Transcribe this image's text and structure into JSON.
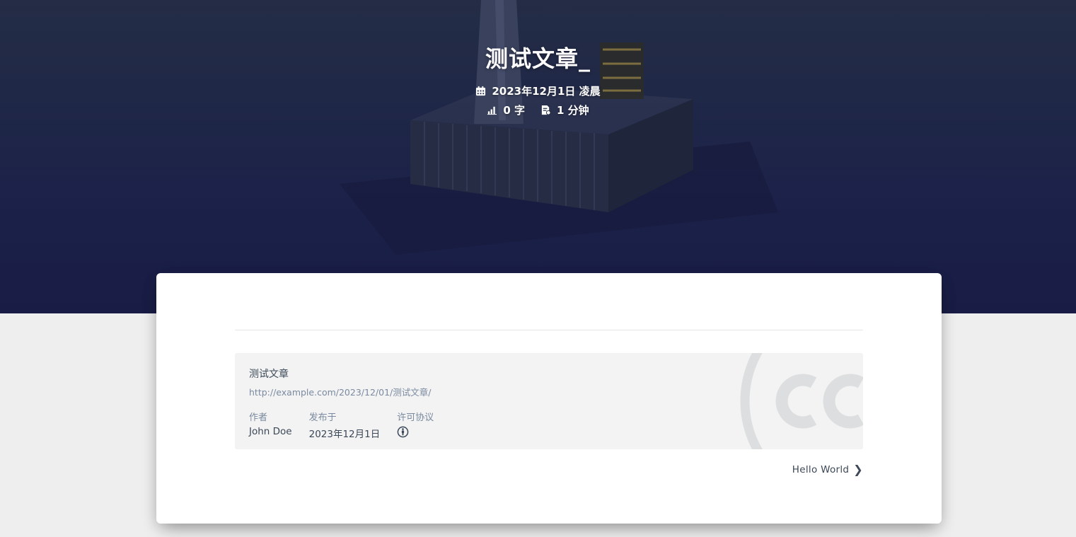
{
  "banner": {
    "title": "测试文章_",
    "date": "2023年12月1日 凌晨",
    "word_count": "0 字",
    "read_time": "1 分钟",
    "icons": {
      "date": "calendar-icon",
      "words": "bar-chart-icon",
      "time": "document-icon"
    }
  },
  "license": {
    "post_title": "测试文章",
    "post_link": "http://example.com/2023/12/01/测试文章/",
    "author_label": "作者",
    "author": "John Doe",
    "published_label": "发布于",
    "published": "2023年12月1日",
    "license_label": "许可协议",
    "license_icon": "cc-by-icon",
    "watermark_icon": "creative-commons-icon"
  },
  "nav": {
    "next_label": "Hello World",
    "next_icon": "chevron-right-icon"
  },
  "colors": {
    "banner_top": "#242d45",
    "banner_bottom": "#191d45",
    "page_bg": "#eeeeee",
    "license_bg": "#f2f3f2",
    "text": "#3c4858",
    "muted": "#7b8aa0"
  }
}
